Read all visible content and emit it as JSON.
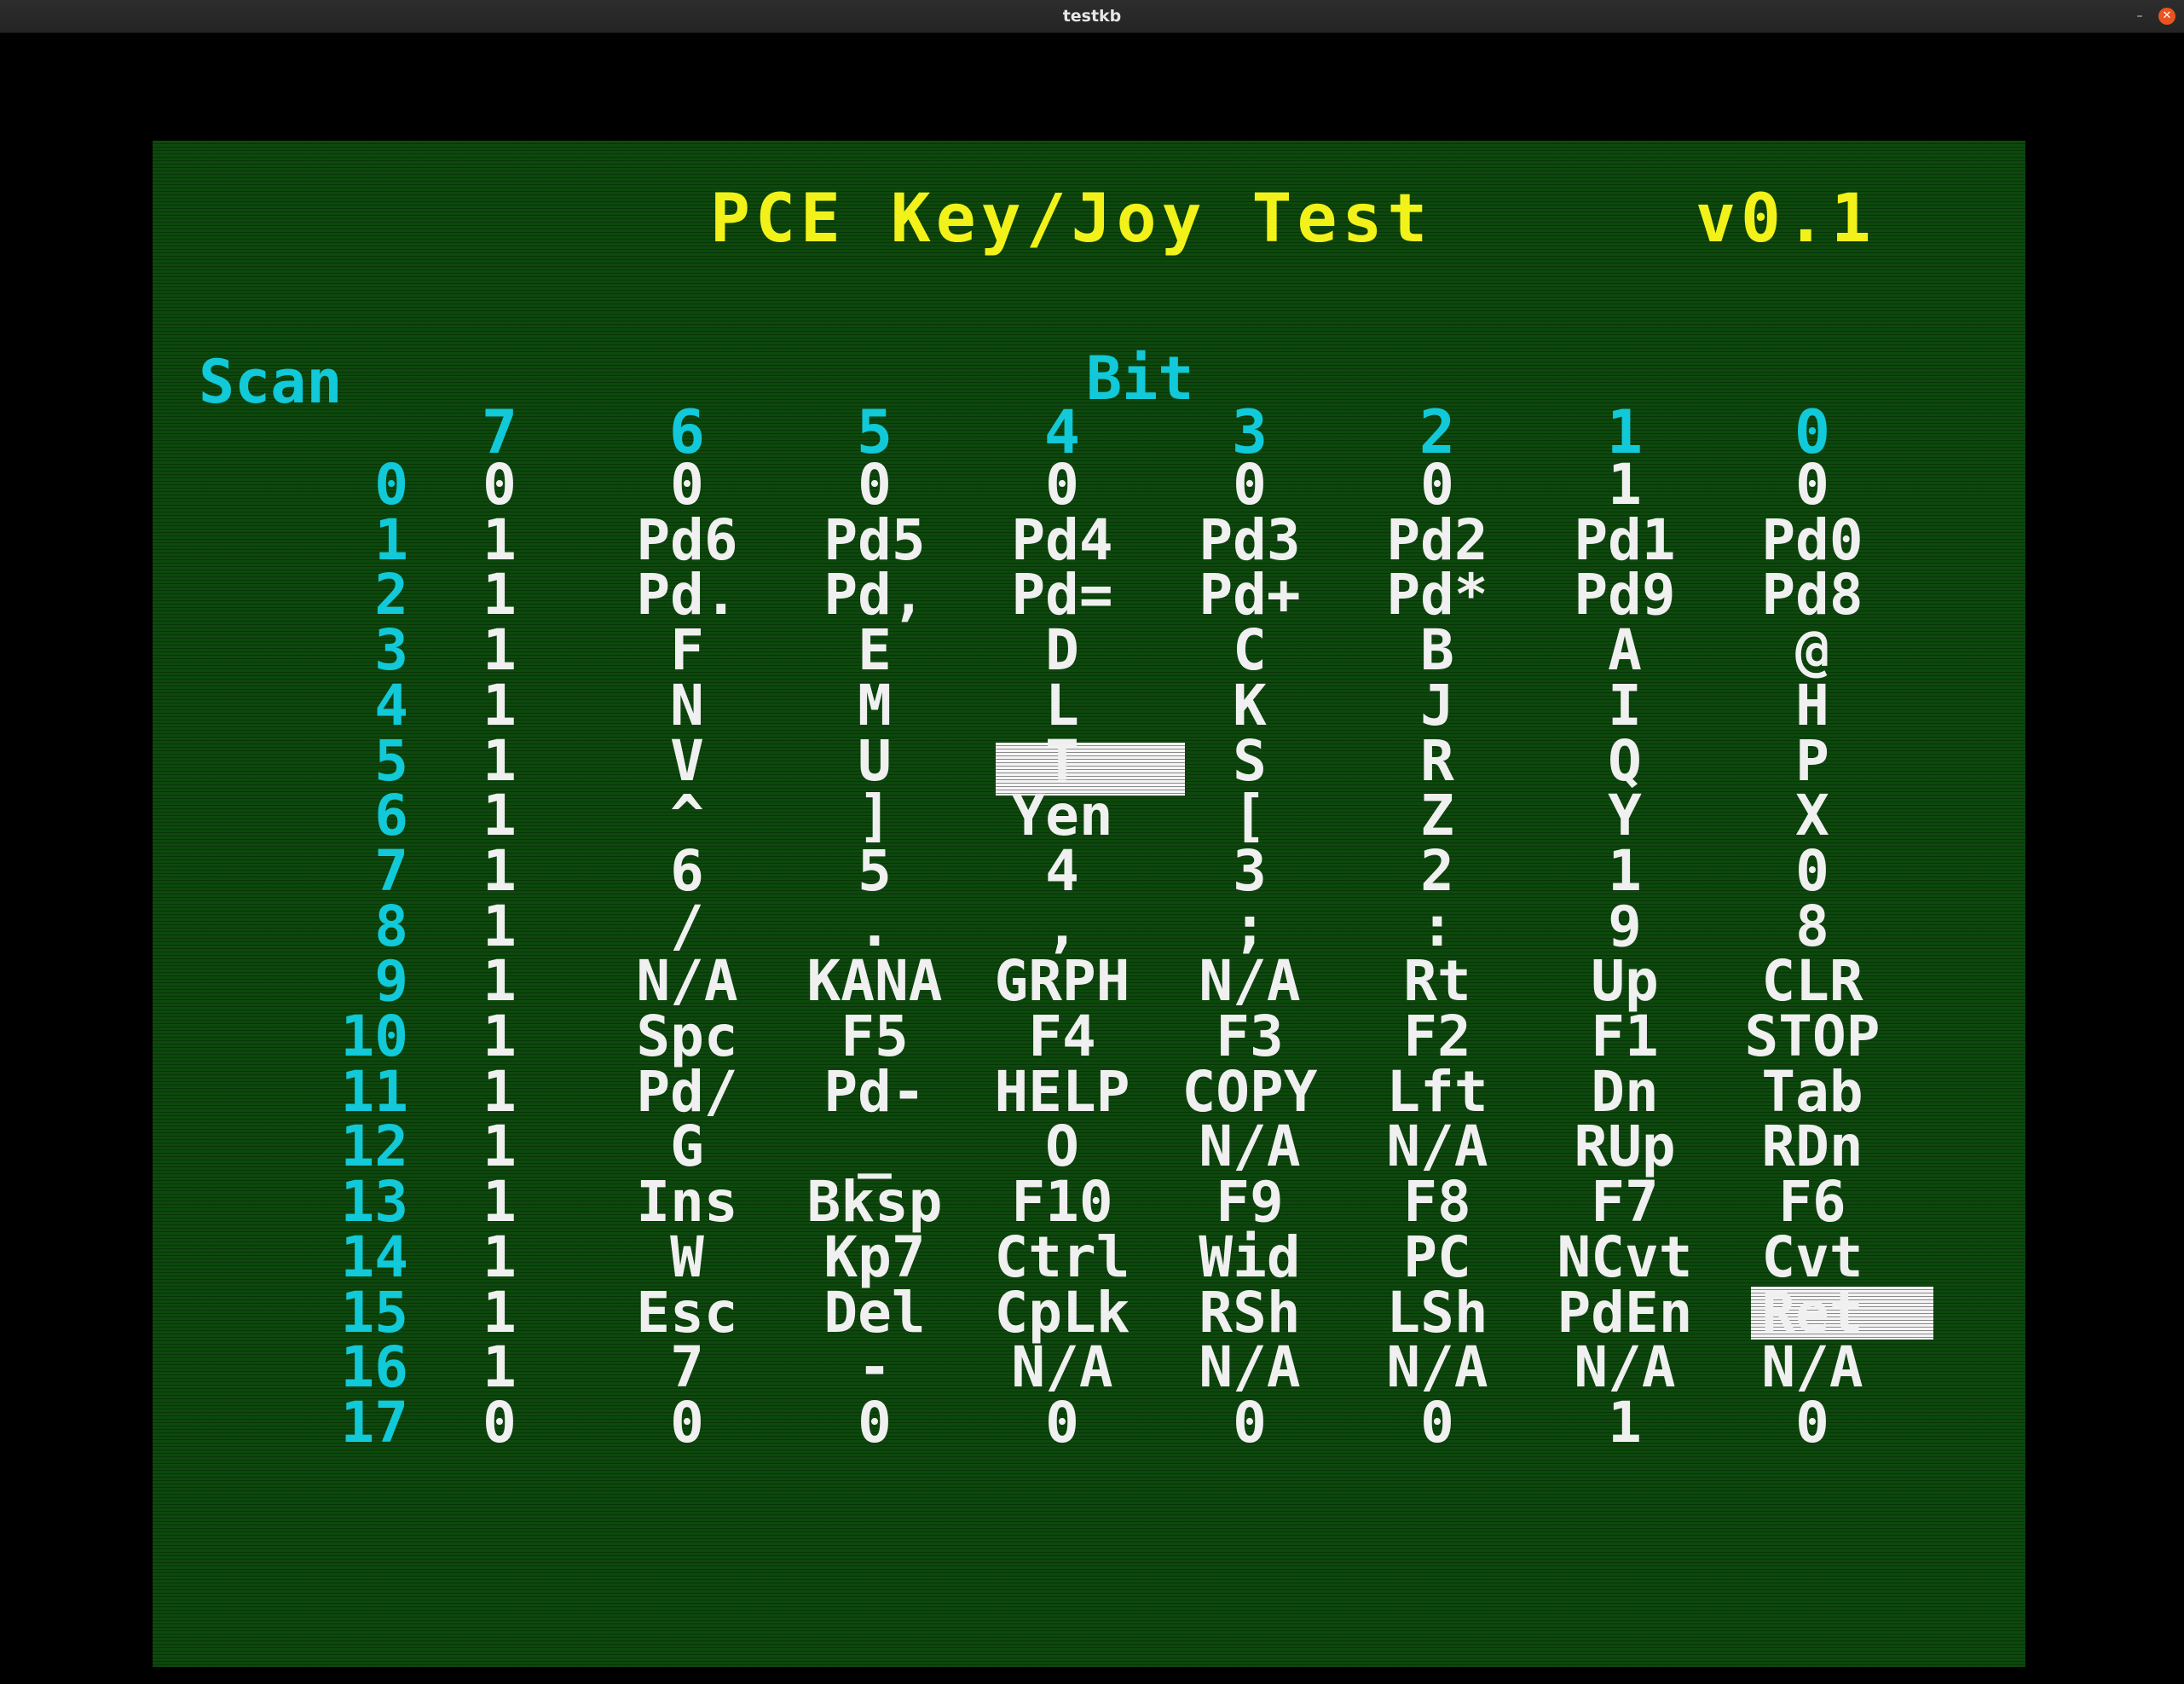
{
  "window": {
    "title": "testkb",
    "minimize_glyph": "–",
    "close_glyph": "✕"
  },
  "screen": {
    "heading": "PCE Key/Joy Test",
    "version": "v0.1",
    "scan_label": "Scan",
    "bit_label": "Bit",
    "bit_numbers": [
      "7",
      "6",
      "5",
      "4",
      "3",
      "2",
      "1",
      "0"
    ],
    "rows": [
      {
        "scan": "0",
        "cells": [
          "0",
          "0",
          "0",
          "0",
          "0",
          "0",
          "1",
          "0"
        ]
      },
      {
        "scan": "1",
        "cells": [
          "1",
          "Pd6",
          "Pd5",
          "Pd4",
          "Pd3",
          "Pd2",
          "Pd1",
          "Pd0"
        ]
      },
      {
        "scan": "2",
        "cells": [
          "1",
          "Pd.",
          "Pd,",
          "Pd=",
          "Pd+",
          "Pd*",
          "Pd9",
          "Pd8"
        ]
      },
      {
        "scan": "3",
        "cells": [
          "1",
          "F",
          "E",
          "D",
          "C",
          "B",
          "A",
          "@"
        ]
      },
      {
        "scan": "4",
        "cells": [
          "1",
          "N",
          "M",
          "L",
          "K",
          "J",
          "I",
          "H"
        ]
      },
      {
        "scan": "5",
        "cells": [
          "1",
          "V",
          "U",
          "T",
          "S",
          "R",
          "Q",
          "P"
        ]
      },
      {
        "scan": "6",
        "cells": [
          "1",
          "^",
          "]",
          "Yen",
          "[",
          "Z",
          "Y",
          "X"
        ]
      },
      {
        "scan": "7",
        "cells": [
          "1",
          "6",
          "5",
          "4",
          "3",
          "2",
          "1",
          "0"
        ]
      },
      {
        "scan": "8",
        "cells": [
          "1",
          "/",
          ".",
          ",",
          ";",
          ":",
          "9",
          "8"
        ]
      },
      {
        "scan": "9",
        "cells": [
          "1",
          "N/A",
          "KANA",
          "GRPH",
          "N/A",
          "Rt",
          "Up",
          "CLR"
        ]
      },
      {
        "scan": "10",
        "cells": [
          "1",
          "Spc",
          "F5",
          "F4",
          "F3",
          "F2",
          "F1",
          "STOP"
        ]
      },
      {
        "scan": "11",
        "cells": [
          "1",
          "Pd/",
          "Pd-",
          "HELP",
          "COPY",
          "Lft",
          "Dn",
          "Tab"
        ]
      },
      {
        "scan": "12",
        "cells": [
          "1",
          "G",
          "_",
          "O",
          "N/A",
          "N/A",
          "RUp",
          "RDn"
        ]
      },
      {
        "scan": "13",
        "cells": [
          "1",
          "Ins",
          "Bksp",
          "F10",
          "F9",
          "F8",
          "F7",
          "F6"
        ]
      },
      {
        "scan": "14",
        "cells": [
          "1",
          "W",
          "Kp7",
          "Ctrl",
          "Wid",
          "PC",
          "NCvt",
          "Cvt"
        ]
      },
      {
        "scan": "15",
        "cells": [
          "1",
          "Esc",
          "Del",
          "CpLk",
          "RSh",
          "LSh",
          "PdEn",
          "Ret"
        ]
      },
      {
        "scan": "16",
        "cells": [
          "1",
          "7",
          "-",
          "N/A",
          "N/A",
          "N/A",
          "N/A",
          "N/A"
        ]
      },
      {
        "scan": "17",
        "cells": [
          "0",
          "0",
          "0",
          "0",
          "0",
          "0",
          "1",
          "0"
        ]
      }
    ]
  },
  "colors": {
    "screen_background": "#0d480d",
    "heading": "#f2f21a",
    "labels": "#11c9d8",
    "values": "#f0f0f0",
    "close_button": "#e95420"
  }
}
